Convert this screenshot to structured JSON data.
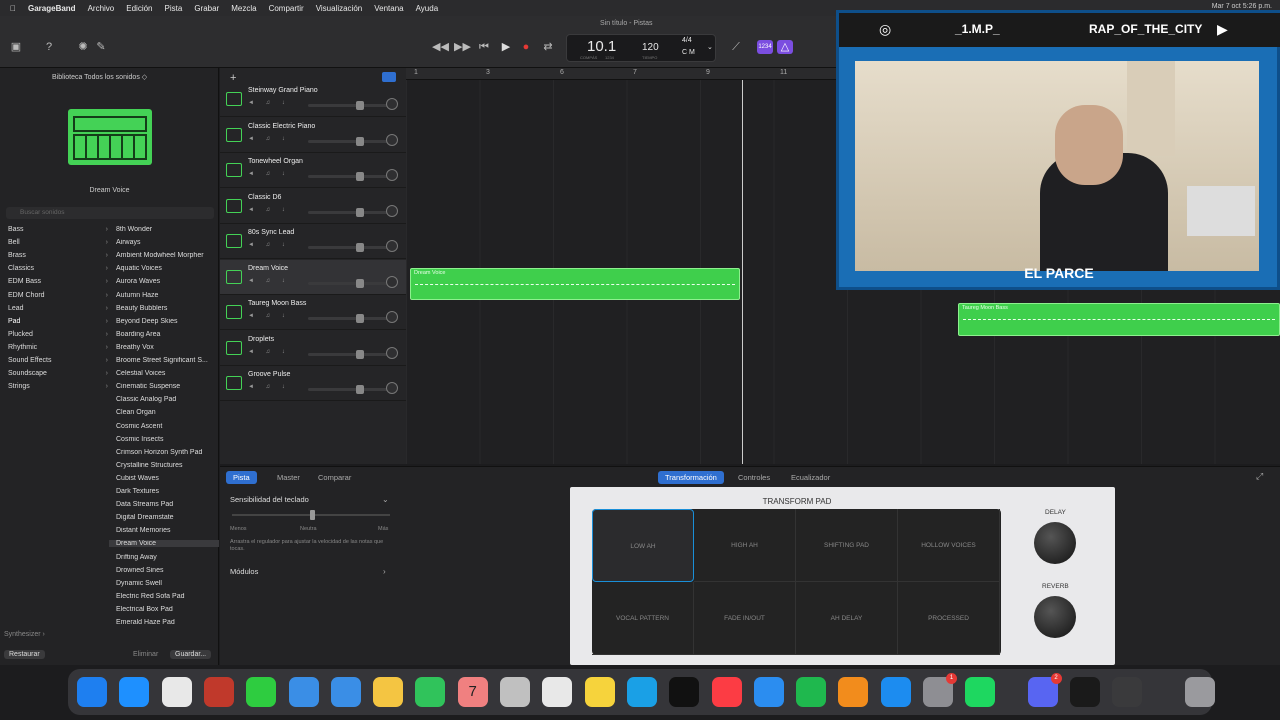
{
  "menubar": {
    "app": "GarageBand",
    "items": [
      "Archivo",
      "Edición",
      "Pista",
      "Grabar",
      "Mezcla",
      "Compartir",
      "Visualización",
      "Ventana",
      "Ayuda"
    ],
    "clock": "Mar 7 oct 5:26 p.m."
  },
  "window": {
    "title": "Sin título - Pistas"
  },
  "lcd": {
    "position": "10.1",
    "tempo": "120",
    "signature": "4/4",
    "key": "C M",
    "compas": "COMPÁS",
    "tiempo": "TIEMPO",
    "count_in": "1234"
  },
  "library": {
    "header": "Biblioteca   Todos los sonidos ◇",
    "instrument": "Dream Voice",
    "search_placeholder": "Buscar sonidos",
    "categories": [
      "Bass",
      "Bell",
      "Brass",
      "Classics",
      "EDM Bass",
      "EDM Chord",
      "Lead",
      "Pad",
      "Plucked",
      "Rhythmic",
      "Sound Effects",
      "Soundscape",
      "Strings"
    ],
    "sounds": [
      "8th Wonder",
      "Airways",
      "Ambient Modwheel Morpher",
      "Aquatic Voices",
      "Aurora Waves",
      "Autumn Haze",
      "Beauty Bubblers",
      "Beyond Deep Skies",
      "Boarding Area",
      "Breathy Vox",
      "Broome Street Significant S...",
      "Celestial Voices",
      "Cinematic Suspense",
      "Classic Analog Pad",
      "Clean Organ",
      "Cosmic Ascent",
      "Cosmic Insects",
      "Crimson Horizon Synth Pad",
      "Crystalline Structures",
      "Cubist Waves",
      "Dark Textures",
      "Data Streams Pad",
      "Digital Dreamstate",
      "Distant Memories",
      "Dream Voice",
      "Drifting Away",
      "Drowned Sines",
      "Dynamic Swell",
      "Electric Red Sofa Pad",
      "Electrical Box Pad",
      "Emerald Haze Pad"
    ],
    "footer_label": "Synthesizer ›",
    "restore": "Restaurar",
    "delete": "Eliminar",
    "save": "Guardar..."
  },
  "tracks": [
    "Steinway Grand Piano",
    "Classic Electric Piano",
    "Tonewheel Organ",
    "Classic D6",
    "80s Sync Lead",
    "Dream Voice",
    "Taureg Moon Bass",
    "Droplets",
    "Groove Pulse"
  ],
  "ruler": [
    "1",
    "3",
    "6",
    "7",
    "9",
    "11"
  ],
  "regions": [
    {
      "label": "Dream Voice"
    },
    {
      "label": "Taureg Moon Bass"
    }
  ],
  "editor": {
    "left_tabs": [
      "Pista",
      "Master",
      "Comparar"
    ],
    "right_tabs": [
      "Transformación",
      "Controles",
      "Ecualizador"
    ],
    "sensitivity": "Sensibilidad del teclado",
    "less": "Menos",
    "neutral": "Neutra",
    "more": "Más",
    "hint": "Arrastra el regulador para ajustar la velocidad de las notas que tocas.",
    "modules": "Módulos",
    "pad_title": "TRANSFORM PAD",
    "cells": [
      "LOW AH",
      "HIGH AH",
      "SHIFTING PAD",
      "HOLLOW VOICES",
      "VOCAL PATTERN",
      "FADE IN/OUT",
      "AH DELAY",
      "PROCESSED"
    ],
    "delay": "DELAY",
    "reverb": "REVERB"
  },
  "overlay": {
    "handle": "_1.M.P_",
    "channel": "RAP_OF_THE_CITY",
    "name": "EL PARCE"
  },
  "dock": {
    "calendar_day": "7",
    "discord_badge": "2",
    "settings_badge": "1",
    "colors": [
      "#1e7ff0",
      "#1e90ff",
      "#e8e8e8",
      "#c0392b",
      "#2ecc40",
      "#3a8ee6",
      "#3a8ee6",
      "#f4c542",
      "#30c35b",
      "#f08080",
      "#c0c0c0",
      "#e8e8e8",
      "#f6d33c",
      "#1aa0e6",
      "#111111",
      "#fc3c44",
      "#2b8df0",
      "#1fb84e",
      "#f28c1c",
      "#1c8cf0",
      "#8e8e93",
      "#1ed760",
      "#5865f2",
      "#1a1a1a",
      "#3a3a3c",
      "#9a9a9e"
    ]
  }
}
